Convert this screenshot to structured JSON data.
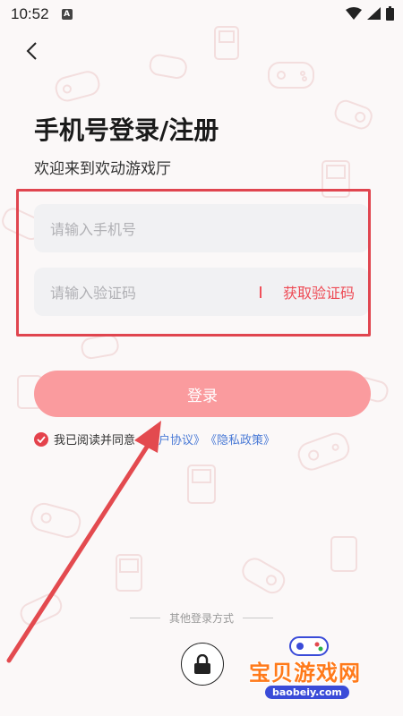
{
  "status_bar": {
    "time": "10:52",
    "notification_letter": "A"
  },
  "header": {
    "title": "手机号登录/注册",
    "subtitle": "欢迎来到欢动游戏厅"
  },
  "form": {
    "phone_placeholder": "请输入手机号",
    "code_placeholder": "请输入验证码",
    "get_code_label": "获取验证码"
  },
  "login_button_label": "登录",
  "agreement": {
    "prefix": "我已阅读并同意",
    "user_agreement": "《用户协议》",
    "privacy_policy": "《隐私政策》"
  },
  "other_login_label": "其他登录方式",
  "watermark": {
    "name": "宝贝游戏网",
    "url": "baobeiy.com"
  },
  "colors": {
    "accent_red": "#e4424c",
    "login_button": "#fa9b9e",
    "link_blue": "#4a7ad6",
    "highlight_border": "#e0454f"
  },
  "icons": {
    "back": "chevron-left-icon",
    "check": "check-circle-icon",
    "alternate_login": "lock-icon"
  }
}
